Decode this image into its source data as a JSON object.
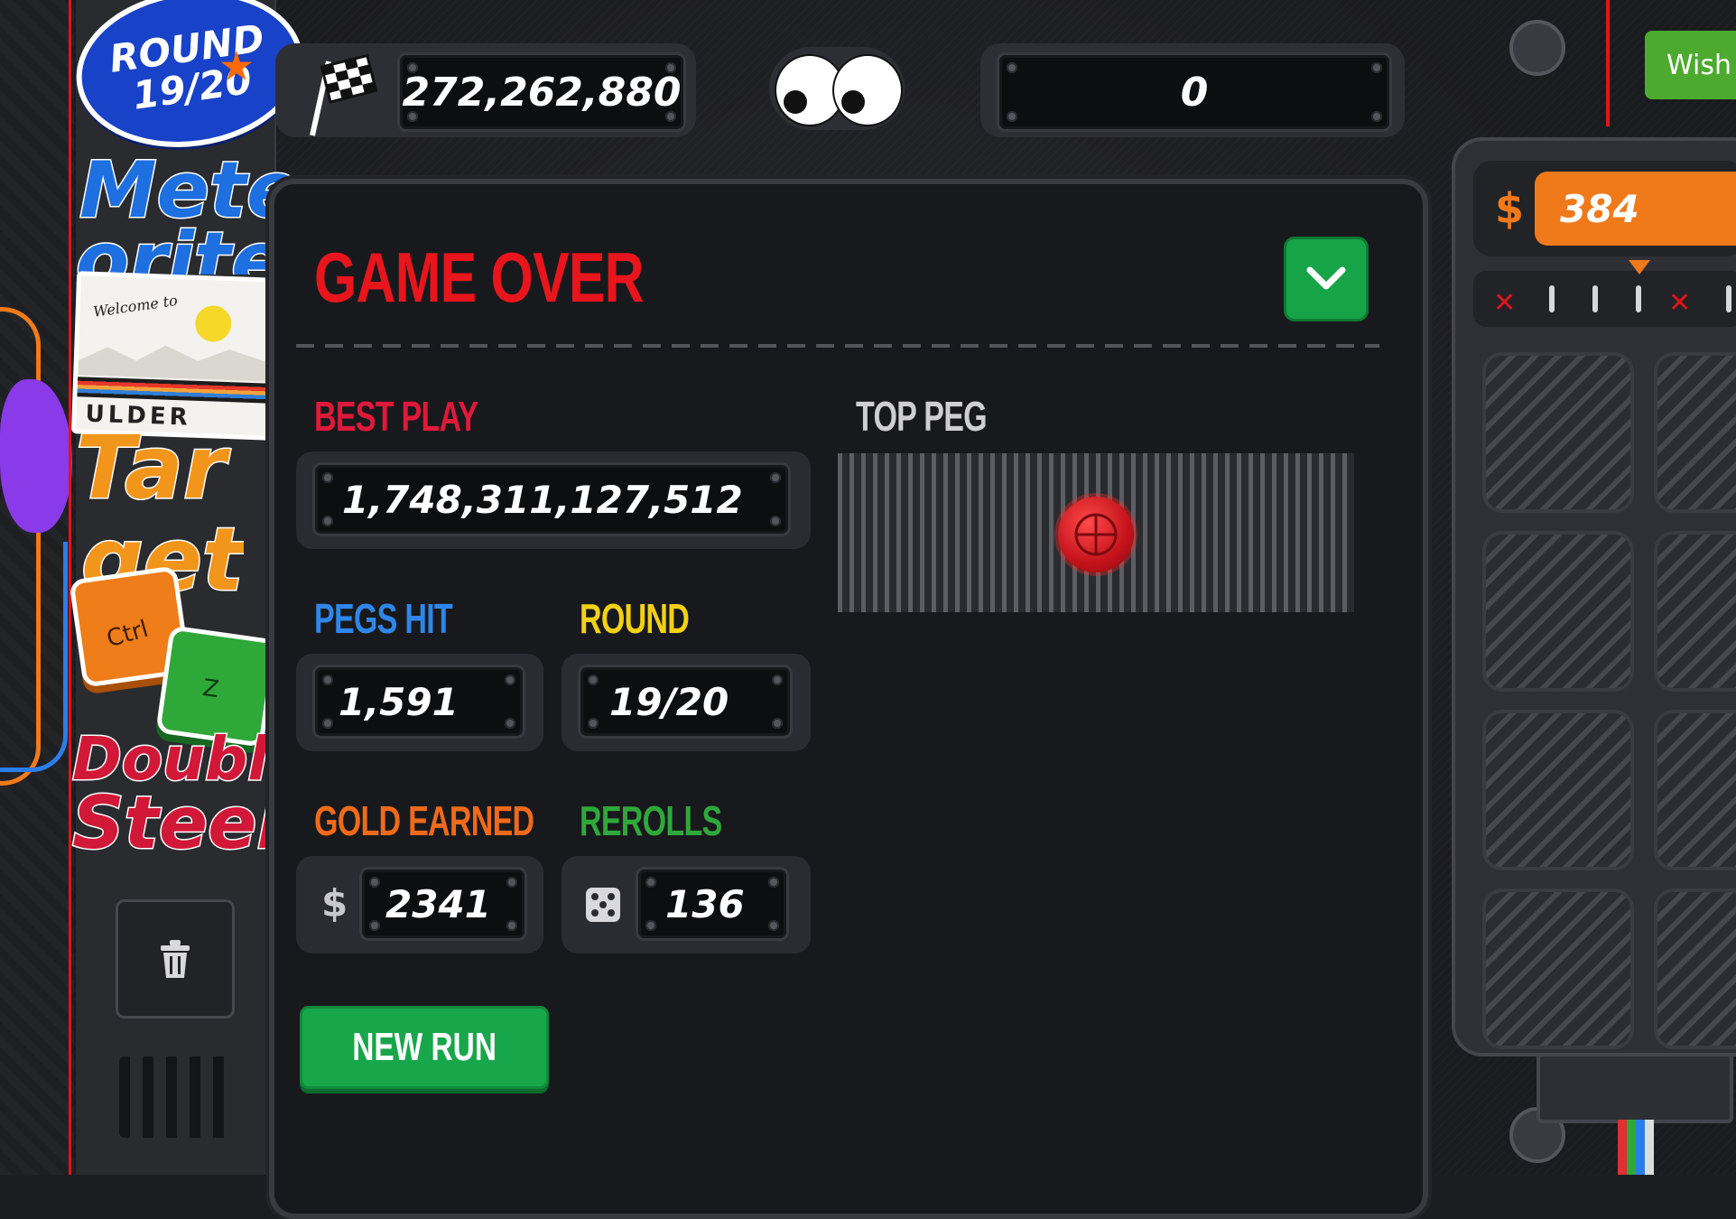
{
  "round_badge": {
    "line1": "ROUND",
    "line2": "19/20"
  },
  "stickers": {
    "word1_top": "Mete",
    "word1_bottom": "orite",
    "postcard_welcome": "Welcome to",
    "postcard_place": "ULDER",
    "word2_top": "Tar",
    "word2_bottom": "get",
    "key_ctrl": "Ctrl",
    "key_z": "Z",
    "word3_top": "Double",
    "word3_bottom": "Steel"
  },
  "top_bar": {
    "score": "272,262,880",
    "right_counter": "0"
  },
  "game_over": {
    "title": "GAME OVER",
    "best_play_label": "BEST PLAY",
    "best_play_value": "1,748,311,127,512",
    "top_peg_label": "TOP PEG",
    "pegs_hit_label": "PEGS HIT",
    "pegs_hit_value": "1,591",
    "round_label": "ROUND",
    "round_value": "19/20",
    "gold_label": "GOLD EARNED",
    "gold_currency": "$",
    "gold_value": "2341",
    "rerolls_label": "REROLLS",
    "rerolls_value": "136",
    "new_run_label": "NEW RUN"
  },
  "shop": {
    "wish_label": "Wish",
    "currency": "$",
    "money": "384"
  },
  "colors": {
    "title_red": "#e8151d",
    "best_play_red": "#e0193a",
    "pegs_blue": "#2f86ea",
    "round_yellow": "#f2d114",
    "gold_orange": "#ef6a1a",
    "rerolls_green": "#2fa83a",
    "button_green": "#18a64a",
    "money_orange": "#f0791a"
  },
  "icons": [
    "checkered-flag-icon",
    "googly-eyes-icon",
    "chevron-down-icon",
    "trash-icon",
    "dice-icon",
    "peg-icon",
    "knob-icon"
  ]
}
